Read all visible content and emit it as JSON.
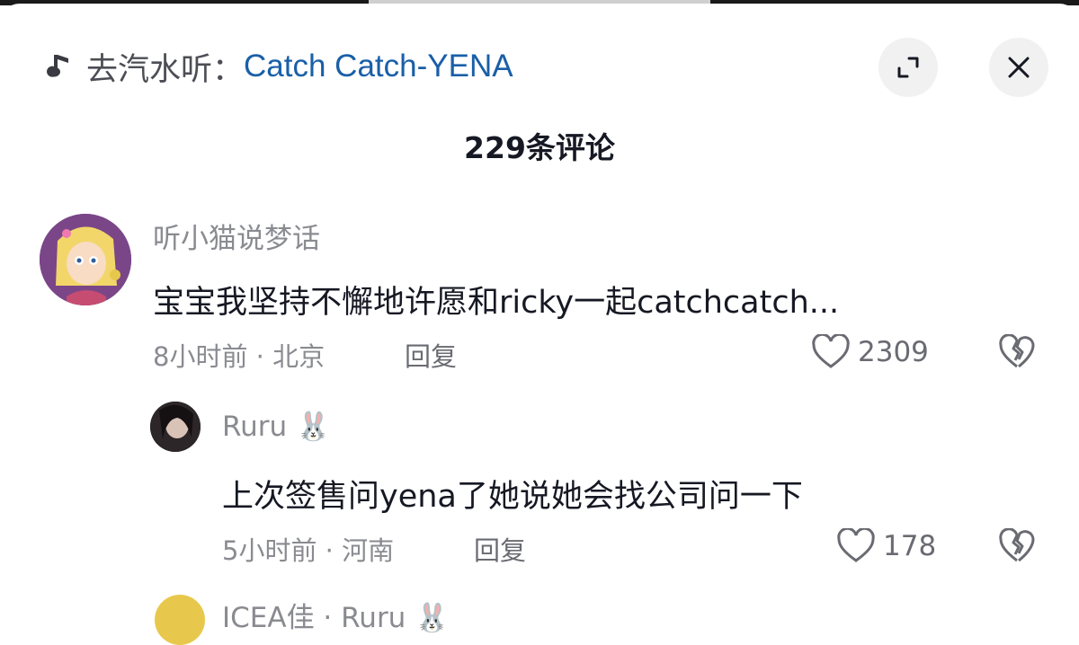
{
  "header": {
    "music_prefix": "去汽水听：",
    "music_song": "Catch Catch-YENA"
  },
  "comment_count": "229条评论",
  "comments": [
    {
      "username": "听小猫说梦话",
      "text": "宝宝我坚持不懈地许愿和ricky一起catchcatch...",
      "time_location": "8小时前 · 北京",
      "reply_label": "回复",
      "likes": "2309"
    },
    {
      "username": "Ruru 🐰",
      "text": "上次签售问yena了她说她会找公司问一下",
      "time_location": "5小时前 · 河南",
      "reply_label": "回复",
      "likes": "178"
    },
    {
      "username": "ICEA佳 · Ruru 🐰"
    }
  ],
  "icons": {
    "music": "music-note-icon",
    "expand": "expand-icon",
    "close": "close-icon",
    "like": "heart-outline-icon",
    "dislike": "broken-heart-icon"
  }
}
